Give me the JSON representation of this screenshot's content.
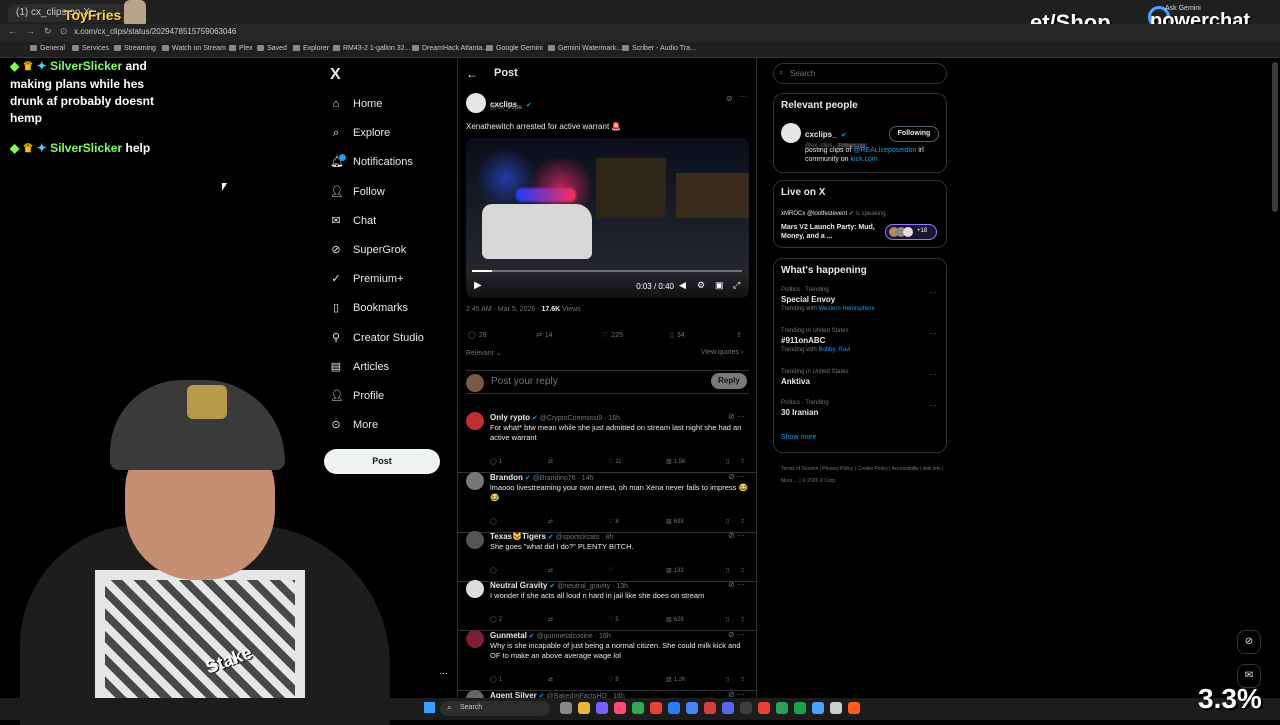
{
  "browser": {
    "tab_title": "(1) cx_clips on X:...",
    "url": "x.com/cx_clips/status/2029478515759063046",
    "bookmarks": [
      "General",
      "Services",
      "Streaming",
      "Watch on Stream",
      "Plex",
      "Saved",
      "Explorer",
      "RM43-2 1-gallon 32...",
      "DreamHack Atlanta...",
      "Google Gemini",
      "Gemini Watermark...",
      "Scriber - Audio Tra..."
    ]
  },
  "stream_overlay": {
    "top_name": "ToyFries",
    "brand_shop": "et/Shop",
    "brand_powerchat": "powerchat",
    "brand_small": "Ask Gemini",
    "percent": "3.3%",
    "webcam_logo": "Stake"
  },
  "chat": [
    {
      "user": "",
      "text": "and",
      "cont": "making plans while hes drunk af probably doesnt hemp"
    },
    {
      "user": "SilverSlicker",
      "text": "help"
    }
  ],
  "chat_first_user": "SilverSlicker",
  "chat_lines": [
    "making plans while hes",
    "drunk af probably doesnt",
    "hemp"
  ],
  "xnav": {
    "logo": "X",
    "items": [
      "Home",
      "Explore",
      "Notifications",
      "Follow",
      "Chat",
      "SuperGrok",
      "Premium+",
      "Bookmarks",
      "Creator Studio",
      "Articles",
      "Profile",
      "More"
    ],
    "post_button": "Post"
  },
  "post": {
    "header": "Post",
    "author_name": "cxclips_",
    "author_handle": "@cx_clips",
    "text": "Xenathewitch arrested for active warrant 🚨",
    "video_time": "0:03 / 0:40",
    "video_progress": 0.075,
    "timestamp": "2:45 AM · Mar 5, 2026",
    "views_count": "17.6K",
    "views_label": "Views",
    "replies": "28",
    "reposts": "14",
    "likes": "225",
    "bookmarks": "34",
    "relevant_label": "Relevant",
    "view_quotes": "View quotes",
    "reply_placeholder": "Post your reply",
    "reply_button": "Reply"
  },
  "replies": [
    {
      "name": "Only rypto",
      "handle": "@CryptoCommissi9 · 16h",
      "text": "For what* btw mean while she just admitted on stream last night she had an active warrant",
      "stats": [
        "1",
        "",
        "11",
        "1.5K"
      ]
    },
    {
      "name": "Brandon",
      "handle": "@Brandino76 · 14h",
      "text": "lmaooo livestreaming your own arrest, oh man Xena never fails to impress 😂😂",
      "stats": [
        "",
        "",
        "8",
        "638"
      ]
    },
    {
      "name": "Texas😼Tigers",
      "handle": "@sportsXcats · 8h",
      "text": "She goes \"what did I do?\" PLENTY BITCH.",
      "stats": [
        "",
        "",
        "",
        "133"
      ]
    },
    {
      "name": "Neutral Gravity",
      "handle": "@neutral_gravity · 13h",
      "text": "I wonder if she acts all loud n hard in jail like she does on stream",
      "stats": [
        "2",
        "",
        "5",
        "628"
      ]
    },
    {
      "name": "Gunmetal",
      "handle": "@gunmetalcosine · 16h",
      "text": "Why is she incapable of just being a normal citizen. She could milk kick and OF to make an above average wage lol",
      "stats": [
        "1",
        "",
        "8",
        "1.2K"
      ]
    },
    {
      "name": "Agent Silver",
      "handle": "@BakedInFactsHQ · 16h",
      "text": "",
      "stats": []
    }
  ],
  "sidebar": {
    "search_placeholder": "Search",
    "relevant_people_title": "Relevant people",
    "rp_name": "cxclips_",
    "rp_handle": "@cx_clips",
    "rp_follows_you": "Follows you",
    "rp_button": "Following",
    "rp_bio_prefix": "posting clips of",
    "rp_bio_link1": "@REALIceposeidon",
    "rp_bio_mid": "irl community on",
    "rp_bio_link2": "kick.com",
    "live_title": "Live on X",
    "live_host": "xMROCx",
    "live_guest": "@lootfestevent",
    "live_status": "is speaking",
    "live_event": "Mars V2 Launch Party: Mud, Money, and a ...",
    "live_count": "+18",
    "happening_title": "What's happening",
    "trends": [
      {
        "context": "Politics · Trending",
        "title": "Special Envoy",
        "sub_prefix": "Trending with",
        "sub_link": "Western Hemisphere"
      },
      {
        "context": "Trending in United States",
        "title": "#911onABC",
        "sub_prefix": "Trending with",
        "sub_link": "Bobby, Ravi"
      },
      {
        "context": "Trending in United States",
        "title": "Anktiva",
        "sub_prefix": "",
        "sub_link": ""
      },
      {
        "context": "Politics · Trending",
        "title": "30 Iranian",
        "sub_prefix": "",
        "sub_link": ""
      }
    ],
    "show_more": "Show more",
    "footer": "Terms of Service  |  Privacy Policy  |  Cookie Policy  |  Accessibility  |  Ads info  |  More ...  |  © 2026 X Corp."
  },
  "taskbar": {
    "search": "Search"
  },
  "colors": {
    "accent": "#1d9bf0",
    "bg": "#000000",
    "border": "#2f3336"
  }
}
